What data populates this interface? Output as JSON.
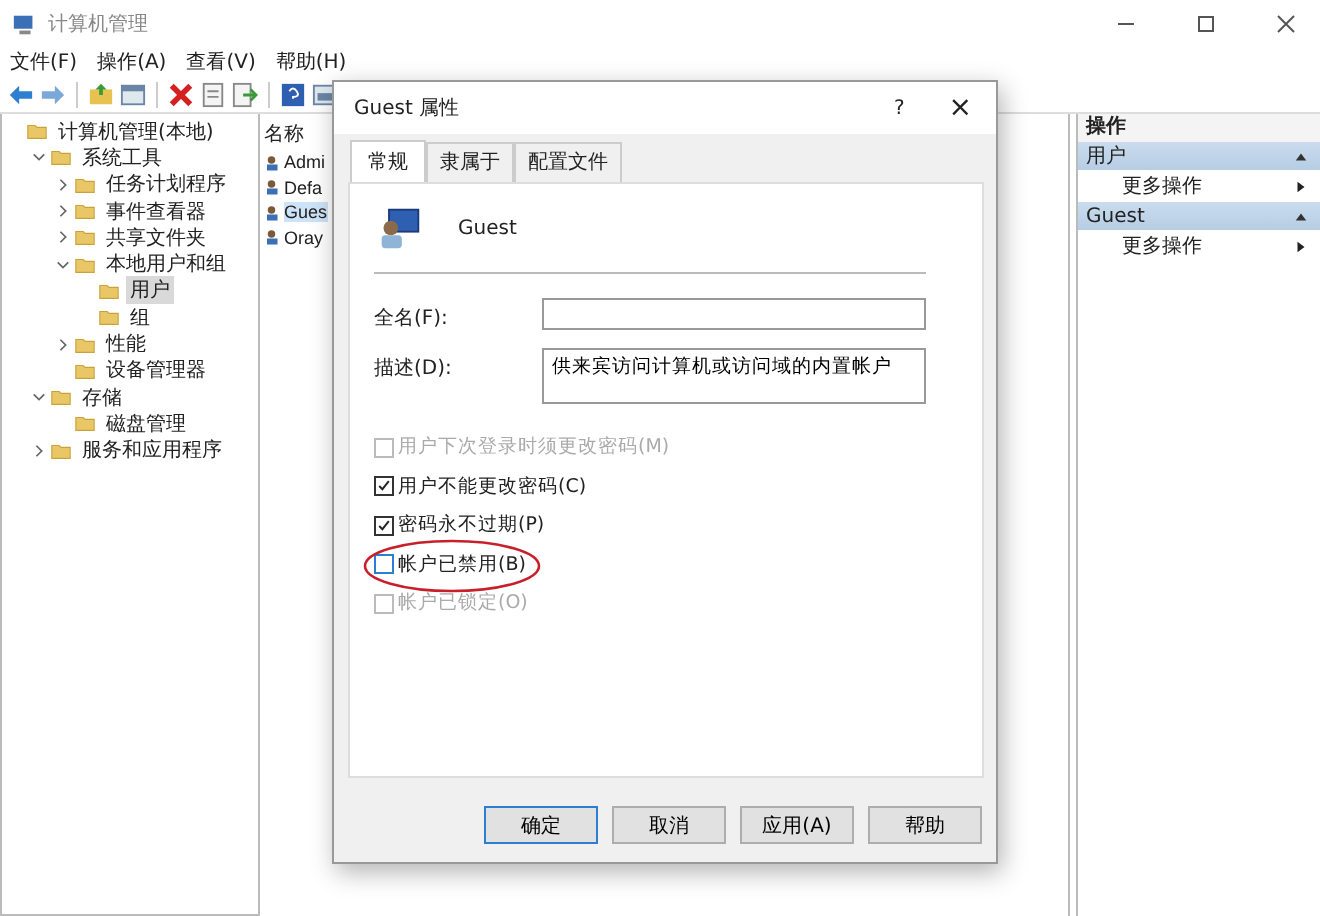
{
  "window": {
    "title": "计算机管理"
  },
  "menu": [
    "文件(F)",
    "操作(A)",
    "查看(V)",
    "帮助(H)"
  ],
  "tree": [
    {
      "label": "计算机管理(本地)",
      "selected": false,
      "children": [
        {
          "label": "系统工具",
          "selected": false,
          "expanded": true,
          "children": [
            {
              "label": "任务计划程序",
              "selected": false,
              "expanded": false
            },
            {
              "label": "事件查看器",
              "selected": false,
              "expanded": false
            },
            {
              "label": "共享文件夹",
              "selected": false,
              "expanded": false
            },
            {
              "label": "本地用户和组",
              "selected": false,
              "expanded": true,
              "children": [
                {
                  "label": "用户",
                  "selected": true
                },
                {
                  "label": "组",
                  "selected": false
                }
              ]
            },
            {
              "label": "性能",
              "selected": false,
              "expanded": false
            },
            {
              "label": "设备管理器",
              "selected": false
            }
          ]
        },
        {
          "label": "存储",
          "selected": false,
          "expanded": true,
          "children": [
            {
              "label": "磁盘管理",
              "selected": false
            }
          ]
        },
        {
          "label": "服务和应用程序",
          "selected": false,
          "expanded": false
        }
      ]
    }
  ],
  "list": {
    "column": "名称",
    "rows": [
      {
        "name": "Admi",
        "selected": false
      },
      {
        "name": "Defa",
        "selected": false
      },
      {
        "name": "Gues",
        "selected": true
      },
      {
        "name": "Oray",
        "selected": false
      }
    ]
  },
  "actions": {
    "title": "操作",
    "sections": [
      {
        "title": "用户",
        "items": [
          "更多操作"
        ]
      },
      {
        "title": "Guest",
        "items": [
          "更多操作"
        ]
      }
    ]
  },
  "dialog": {
    "title": "Guest 属性",
    "help": "?",
    "close": "×",
    "tabs": [
      {
        "label": "常规",
        "selected": true
      },
      {
        "label": "隶属于",
        "selected": false
      },
      {
        "label": "配置文件",
        "selected": false
      }
    ],
    "user_name": "Guest",
    "fields": [
      {
        "label": "全名(F):"
      },
      {
        "label": "描述(D):",
        "value": "供来宾访问计算机或访问域的内置帐户"
      }
    ],
    "checkboxes": [
      {
        "label": "用户下次登录时须更改密码(M)",
        "checked": false,
        "disabled": true,
        "highlighted": false
      },
      {
        "label": "用户不能更改密码(C)",
        "checked": true,
        "disabled": false,
        "highlighted": false
      },
      {
        "label": "密码永不过期(P)",
        "checked": true,
        "disabled": false,
        "highlighted": false
      },
      {
        "label": "帐户已禁用(B)",
        "checked": false,
        "disabled": false,
        "highlighted": true
      },
      {
        "label": "帐户已锁定(O)",
        "checked": false,
        "disabled": true,
        "highlighted": false
      }
    ],
    "buttons": [
      {
        "label": "确定",
        "default": true
      },
      {
        "label": "取消",
        "default": false
      },
      {
        "label": "应用(A)",
        "default": false
      },
      {
        "label": "帮助",
        "default": false
      }
    ]
  }
}
